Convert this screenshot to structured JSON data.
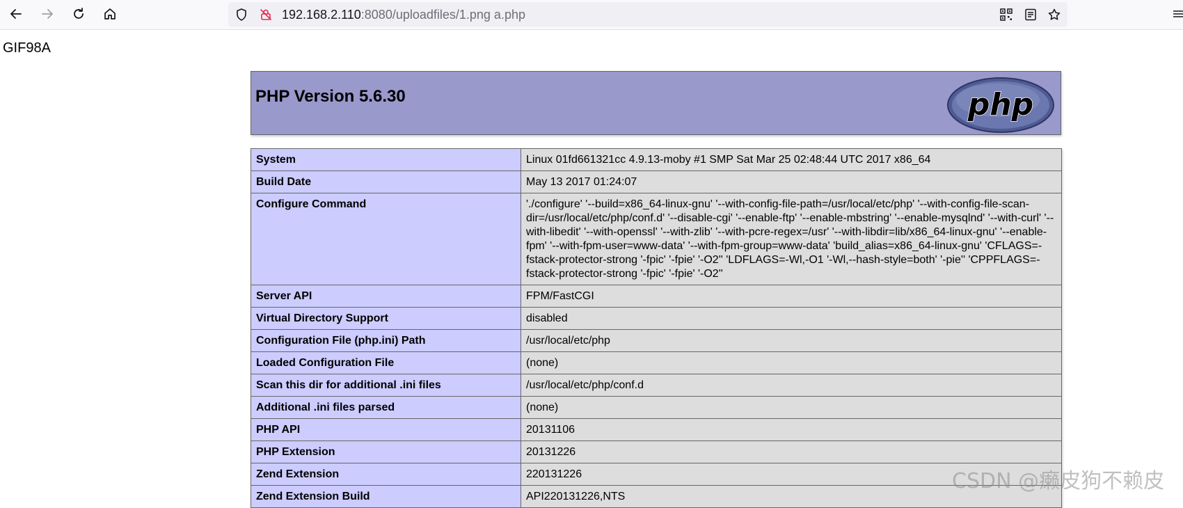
{
  "browser": {
    "url_host": "192.168.2.110",
    "url_rest": ":8080/uploadfiles/1.png a.php",
    "icons": [
      "back-arrow-icon",
      "forward-arrow-icon",
      "reload-icon",
      "home-icon",
      "shield-icon",
      "insecure-lock-icon",
      "qr-code-icon",
      "reader-view-icon",
      "bookmark-star-icon",
      "overflow-menu-icon"
    ]
  },
  "page": {
    "gif_marker": "GIF98A",
    "title": "PHP Version 5.6.30",
    "logo_text": "php",
    "rows": [
      {
        "key": "System",
        "value": "Linux 01fd661321cc 4.9.13-moby #1 SMP Sat Mar 25 02:48:44 UTC 2017 x86_64"
      },
      {
        "key": "Build Date",
        "value": "May 13 2017 01:24:07"
      },
      {
        "key": "Configure Command",
        "value": "'./configure' '--build=x86_64-linux-gnu' '--with-config-file-path=/usr/local/etc/php' '--with-config-file-scan-dir=/usr/local/etc/php/conf.d' '--disable-cgi' '--enable-ftp' '--enable-mbstring' '--enable-mysqlnd' '--with-curl' '--with-libedit' '--with-openssl' '--with-zlib' '--with-pcre-regex=/usr' '--with-libdir=lib/x86_64-linux-gnu' '--enable-fpm' '--with-fpm-user=www-data' '--with-fpm-group=www-data' 'build_alias=x86_64-linux-gnu' 'CFLAGS=-fstack-protector-strong '-fpic' '-fpie' '-O2'' 'LDFLAGS=-Wl,-O1 '-Wl,--hash-style=both' '-pie'' 'CPPFLAGS=-fstack-protector-strong '-fpic' '-fpie' '-O2''"
      },
      {
        "key": "Server API",
        "value": "FPM/FastCGI"
      },
      {
        "key": "Virtual Directory Support",
        "value": "disabled"
      },
      {
        "key": "Configuration File (php.ini) Path",
        "value": "/usr/local/etc/php"
      },
      {
        "key": "Loaded Configuration File",
        "value": "(none)"
      },
      {
        "key": "Scan this dir for additional .ini files",
        "value": "/usr/local/etc/php/conf.d"
      },
      {
        "key": "Additional .ini files parsed",
        "value": "(none)"
      },
      {
        "key": "PHP API",
        "value": "20131106"
      },
      {
        "key": "PHP Extension",
        "value": "20131226"
      },
      {
        "key": "Zend Extension",
        "value": "220131226"
      },
      {
        "key": "Zend Extension Build",
        "value": "API220131226,NTS"
      }
    ]
  },
  "watermark": "CSDN @癞皮狗不赖皮",
  "colors": {
    "header_bg": "#9999cc",
    "key_bg": "#ccccff",
    "value_bg": "#dddddd"
  }
}
